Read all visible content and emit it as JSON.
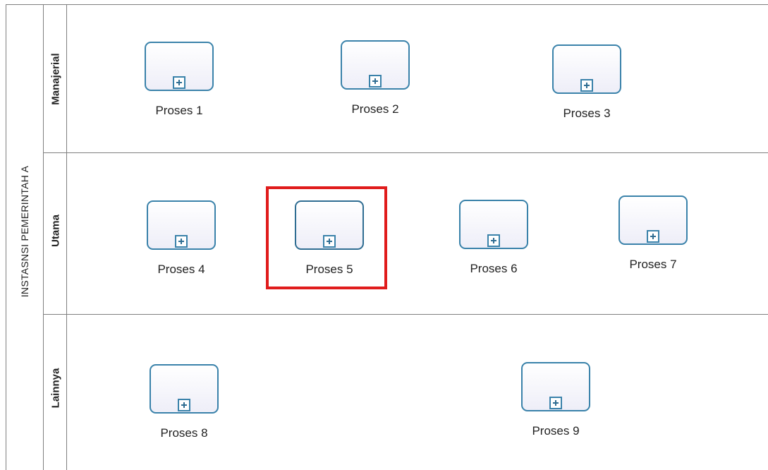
{
  "pool": {
    "title": "INSTASNSI PEMERINTAH A"
  },
  "lanes": [
    {
      "name": "Manajerial"
    },
    {
      "name": "Utama"
    },
    {
      "name": "Lainnya"
    }
  ],
  "tasks": [
    {
      "label": "Proses 1",
      "lane": "Manajerial",
      "type": "collapsed-subprocess"
    },
    {
      "label": "Proses 2",
      "lane": "Manajerial",
      "type": "collapsed-subprocess"
    },
    {
      "label": "Proses 3",
      "lane": "Manajerial",
      "type": "collapsed-subprocess"
    },
    {
      "label": "Proses 4",
      "lane": "Utama",
      "type": "collapsed-subprocess"
    },
    {
      "label": "Proses 5",
      "lane": "Utama",
      "type": "collapsed-subprocess",
      "highlighted": true
    },
    {
      "label": "Proses 6",
      "lane": "Utama",
      "type": "collapsed-subprocess"
    },
    {
      "label": "Proses 7",
      "lane": "Utama",
      "type": "collapsed-subprocess"
    },
    {
      "label": "Proses 8",
      "lane": "Lainnya",
      "type": "collapsed-subprocess"
    },
    {
      "label": "Proses 9",
      "lane": "Lainnya",
      "type": "collapsed-subprocess"
    }
  ],
  "colors": {
    "task_border": "#3a82aa",
    "highlight": "#e01c1c",
    "lane_line": "#7f7f7f"
  }
}
